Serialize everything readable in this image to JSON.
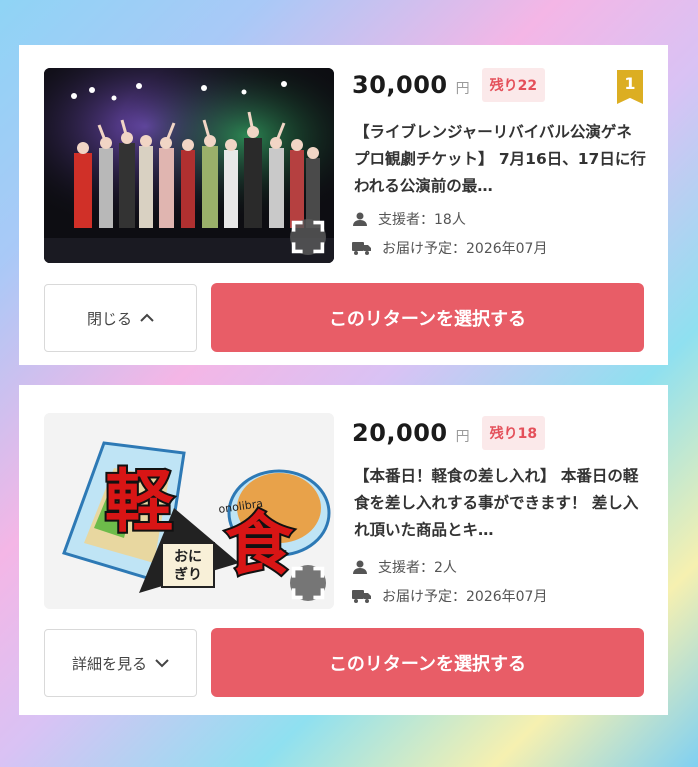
{
  "rewards": [
    {
      "price": "30,000",
      "currency": "円",
      "remaining": "残り22",
      "rank": "1",
      "description": "【ライブレンジャーリバイバル公演ゲネプロ観劇チケット】 7月16日、17日に行われる公演前の最…",
      "supporters": "支援者：18人",
      "delivery": "お届け予定：2026年07月",
      "toggle_label": "閉じる",
      "select_label": "このリターンを選択する"
    },
    {
      "price": "20,000",
      "currency": "円",
      "remaining": "残り18",
      "description": "【本番日！軽食の差し入れ】 本番日の軽食を差し入れする事ができます！ 差し入れ頂いた商品とキ…",
      "supporters": "支援者：2人",
      "delivery": "お届け予定：2026年07月",
      "toggle_label": "詳細を見る",
      "select_label": "このリターンを選択する",
      "image_text": {
        "big_char_1": "軽",
        "big_char_2": "食",
        "onigiri": "おに\nぎり",
        "bread_label": "onolibra"
      }
    }
  ],
  "colors": {
    "accent": "#e85d67",
    "badge_bg": "#fbe9ea",
    "rank_gold": "#dcae22"
  },
  "icons": [
    "expand-icon",
    "person-icon",
    "truck-icon",
    "chevron-up-icon",
    "chevron-down-icon"
  ]
}
